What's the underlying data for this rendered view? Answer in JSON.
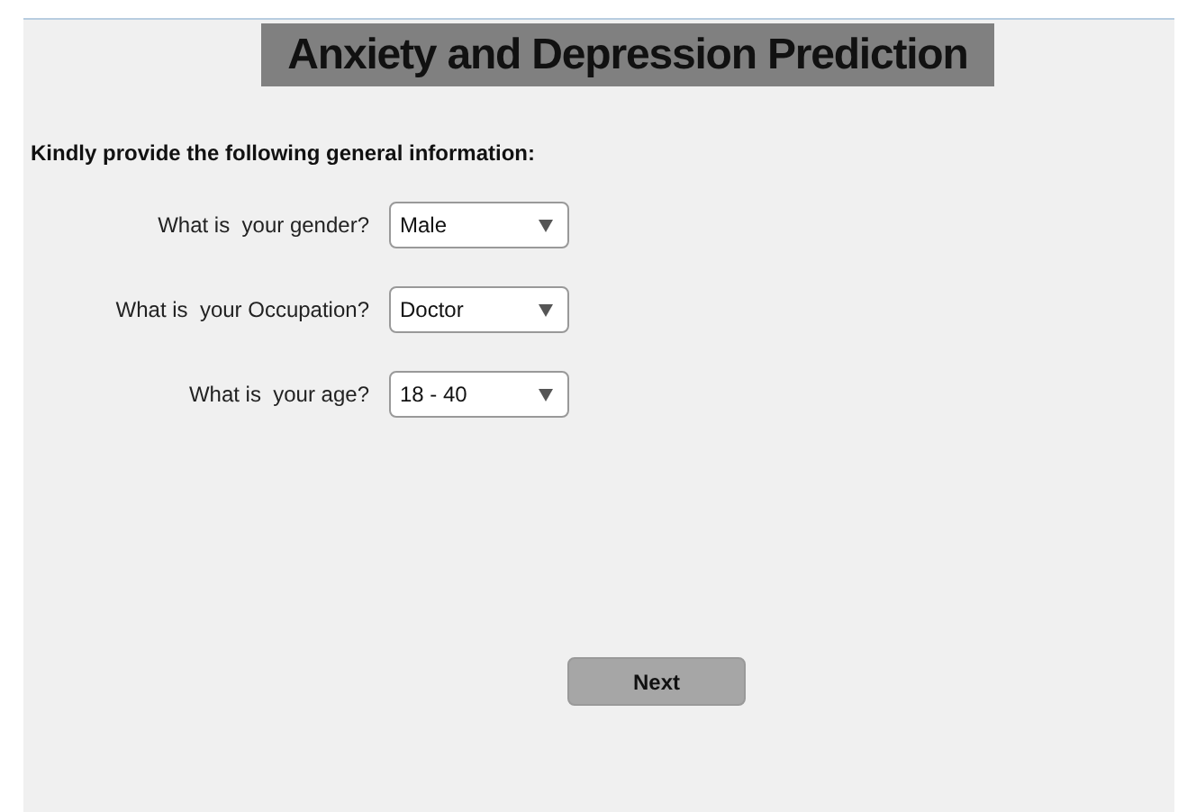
{
  "title": "Anxiety and Depression Prediction",
  "intro": "Kindly provide the following general information:",
  "questions": [
    {
      "label": "What is  your gender?",
      "value": "Male"
    },
    {
      "label": "What is  your Occupation?",
      "value": "Doctor"
    },
    {
      "label": "What is  your age?",
      "value": "18 - 40"
    }
  ],
  "button": "Next"
}
